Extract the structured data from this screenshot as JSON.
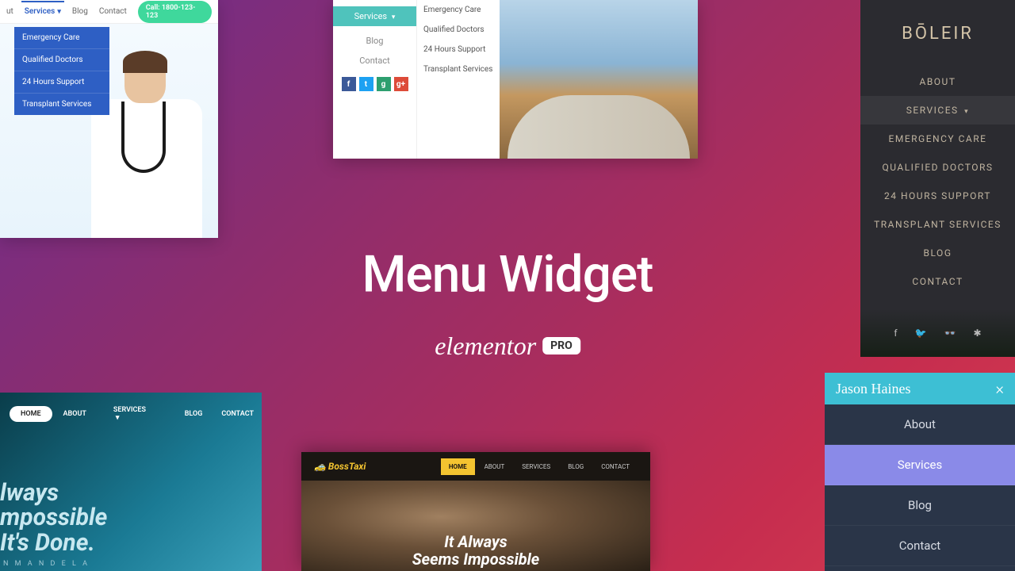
{
  "center": {
    "title": "Menu Widget",
    "brand": "elementor",
    "pro": "PRO"
  },
  "panelA": {
    "nav": {
      "about": "ut",
      "services": "Services",
      "blog": "Blog",
      "contact": "Contact",
      "cta": "Call: 1800-123-123"
    },
    "dropdown": [
      "Emergency Care",
      "Qualified Doctors",
      "24 Hours Support",
      "Transplant Services"
    ]
  },
  "panelB": {
    "side": {
      "services": "Services",
      "blog": "Blog",
      "contact": "Contact"
    },
    "sub": [
      "Emergency Care",
      "Qualified Doctors",
      "24 Hours Support",
      "Transplant Services"
    ],
    "social": {
      "fb": "f",
      "tw": "t",
      "g": "g",
      "gp": "g+"
    }
  },
  "panelC": {
    "logo": "BŌLEIR",
    "items": [
      "About",
      "Services",
      "Emergency Care",
      "Qualified Doctors",
      "24 Hours Support",
      "Transplant Services",
      "Blog",
      "Contact"
    ],
    "social": {
      "fb": "f",
      "tw": "🐦",
      "ta": "👓",
      "yelp": "✱"
    }
  },
  "panelD": {
    "nav": {
      "home": "HOME",
      "about": "ABOUT",
      "services": "SERVICES",
      "blog": "BLOG",
      "contact": "CONTACT"
    },
    "headline1": "lways",
    "headline2": "mpossible",
    "headline3": "It's Done.",
    "attribution": "N   M A N D E L A"
  },
  "panelE": {
    "logo": "BossTaxi",
    "nav": {
      "home": "HOME",
      "about": "ABOUT",
      "services": "SERVICES",
      "blog": "BLOG",
      "contact": "CONTACT"
    },
    "line1": "It Always",
    "line2": "Seems Impossible"
  },
  "panelF": {
    "name": "Jason Haines",
    "close": "×",
    "items": {
      "about": "About",
      "services": "Services",
      "blog": "Blog",
      "contact": "Contact"
    }
  }
}
